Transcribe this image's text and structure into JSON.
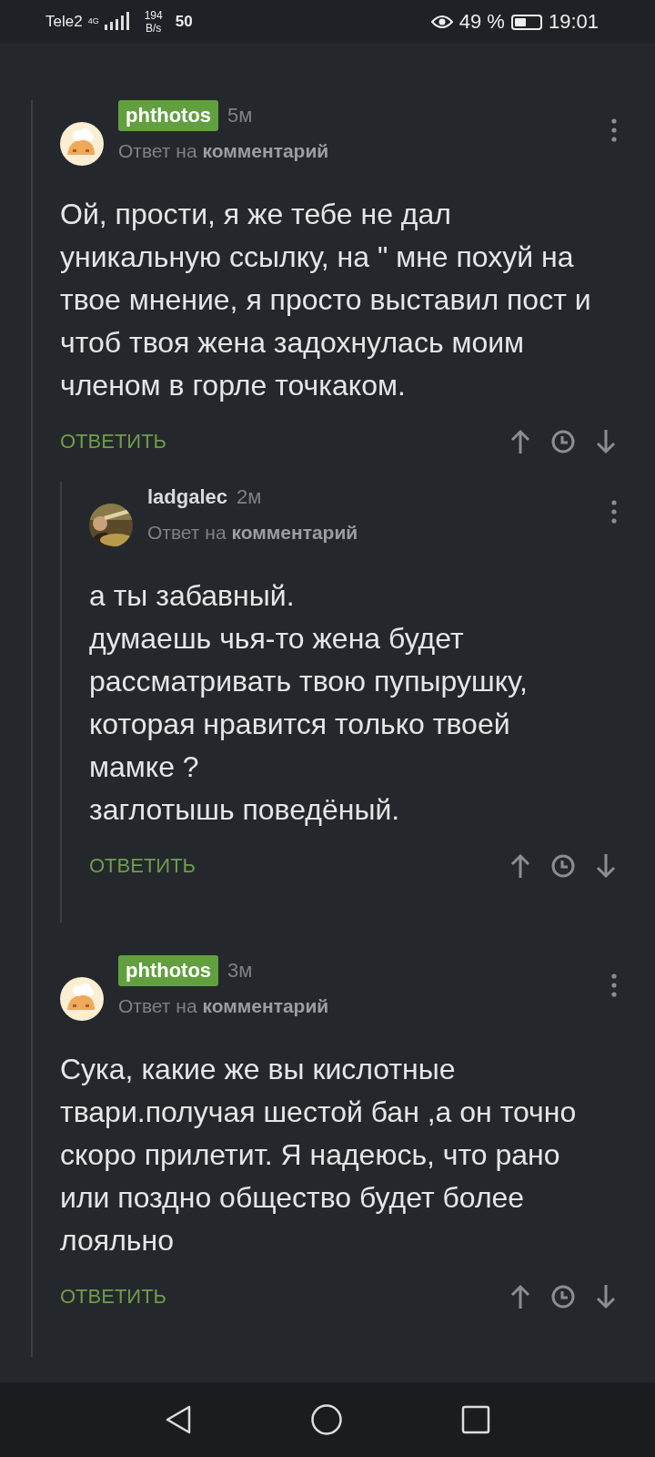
{
  "status_bar": {
    "carrier": "Tele2",
    "network": "4G",
    "speed_value": "194",
    "speed_unit": "B/s",
    "notification": "50",
    "battery_text": "49 %",
    "time": "19:01"
  },
  "comments": [
    {
      "author": "phthotos",
      "highlighted": true,
      "time": "5м",
      "reply_to": "Ответ на **комментарий**",
      "text": "Ой, прости, я же тебе не дал уникальную ссылку, на \" мне похуй на твое мнение, я просто выставил пост и чтоб твоя жена задохнулась моим членом в горле точкаком.",
      "reply": "ОТВЕТИТЬ",
      "children": [
        {
          "author": "ladgalec",
          "highlighted": false,
          "time": "2м",
          "reply_to": "Ответ на **комментарий**",
          "text": "а ты забавный.\nдумаешь чья-то жена будет рассматривать твою пупырушку, которая нравится только твоей мамке ?\nзаглотышь поведёный.",
          "reply": "ОТВЕТИТЬ"
        }
      ]
    },
    {
      "author": "phthotos",
      "highlighted": true,
      "time": "3м",
      "reply_to": "Ответ на **комментарий**",
      "text": "Сука, какие же вы кислотные твари.получая шестой бан ,а он точно скоро прилетит. Я надеюсь, что рано или поздно общество будет более лояльно",
      "reply": "ОТВЕТИТЬ"
    }
  ]
}
